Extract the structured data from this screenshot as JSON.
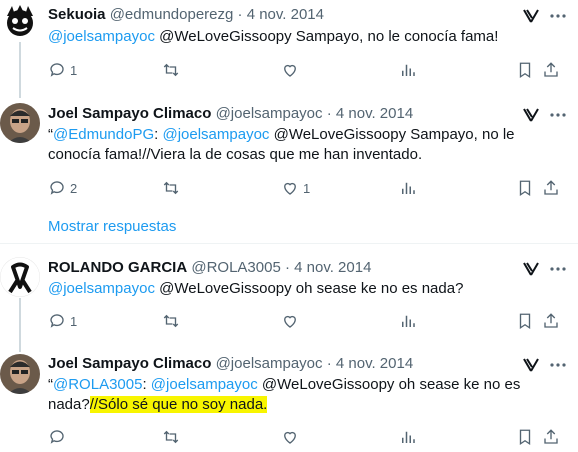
{
  "tweets": [
    {
      "name": "Sekuoia",
      "handle": "@edmundoperezg",
      "dot": "·",
      "date": "4 nov. 2014",
      "body": [
        {
          "text": "@joelsampayoc",
          "mention": true
        },
        {
          "text": " @WeLoveGissoopy Sampayo, no le conocía fama!",
          "mention": false
        }
      ],
      "counts": {
        "reply": "1",
        "retweet": "",
        "like": ""
      }
    },
    {
      "name": "Joel Sampayo Climaco",
      "handle": "@joelsampayoc",
      "dot": "·",
      "date": "4 nov. 2014",
      "body": [
        {
          "text": "“",
          "mention": false
        },
        {
          "text": "@EdmundoPG",
          "mention": true
        },
        {
          "text": ": ",
          "mention": false
        },
        {
          "text": "@joelsampayoc",
          "mention": true
        },
        {
          "text": " @WeLoveGissoopy Sampayo, no le conocía fama!//Viera la de cosas que me han inventado.",
          "mention": false
        }
      ],
      "counts": {
        "reply": "2",
        "retweet": "",
        "like": "1"
      }
    },
    {
      "name": "ROLANDO GARCIA",
      "handle": "@ROLA3005",
      "dot": "·",
      "date": "4 nov. 2014",
      "body": [
        {
          "text": "@joelsampayoc",
          "mention": true
        },
        {
          "text": " @WeLoveGissoopy oh sease ke no es nada?",
          "mention": false
        }
      ],
      "counts": {
        "reply": "1",
        "retweet": "",
        "like": ""
      }
    },
    {
      "name": "Joel Sampayo Climaco",
      "handle": "@joelsampayoc",
      "dot": "·",
      "date": "4 nov. 2014",
      "body_pre": "“",
      "body_mention1": "@ROLA3005",
      "body_colon": ": ",
      "body_mention2": "@joelsampayoc",
      "body_rest": " @WeLoveGissoopy oh sease ke no es nada?",
      "body_highlight": "//Sólo sé que no soy nada.",
      "counts": {
        "reply": "",
        "retweet": "",
        "like": ""
      }
    }
  ],
  "show_more": "Mostrar respuestas",
  "colors": {
    "accent": "#1d9bf0",
    "muted": "#536471",
    "highlight": "#f8f500"
  },
  "icons": [
    "reply-icon",
    "retweet-icon",
    "like-icon",
    "views-icon",
    "bookmark-icon",
    "share-icon",
    "grok-icon",
    "more-icon"
  ]
}
